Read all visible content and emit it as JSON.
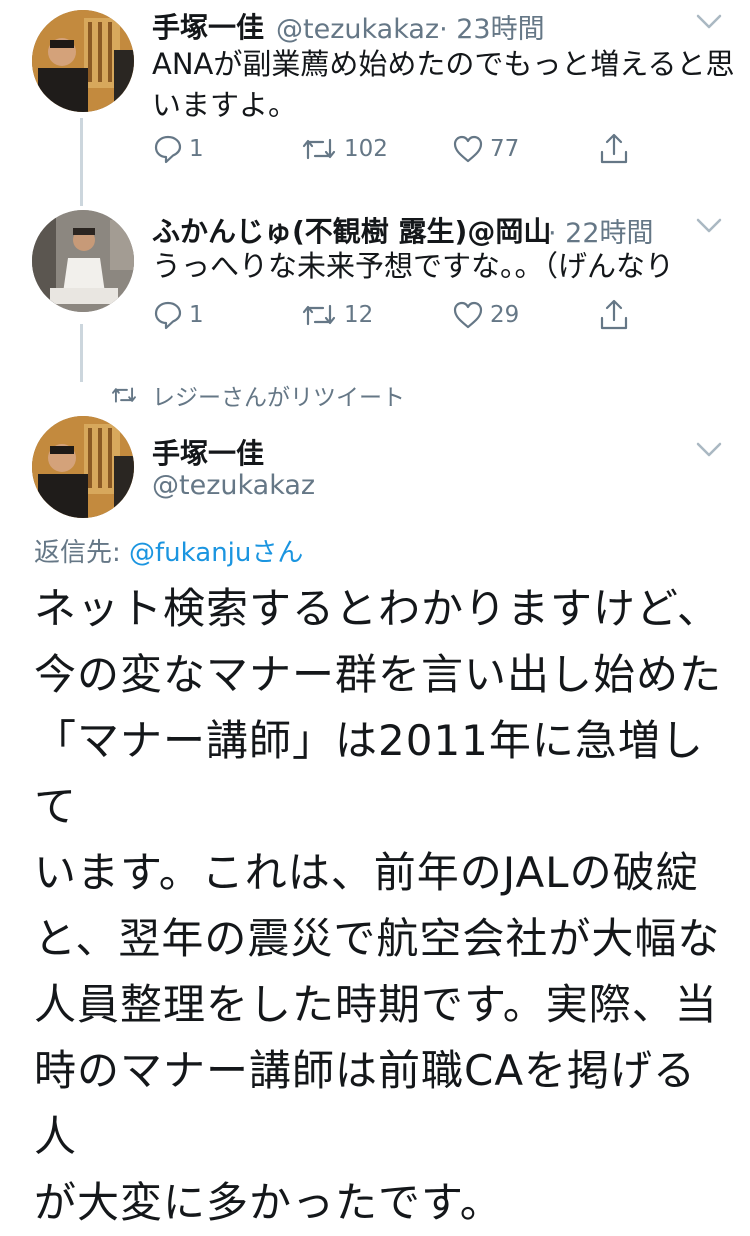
{
  "tweets": [
    {
      "name": "手塚一佳",
      "handle": "@tezukakaz",
      "time": "· 23時間",
      "text_line1": "ANAが副業薦め始めたのでもっと増えると思",
      "text_line2": "いますよ。",
      "replies": "1",
      "retweets": "102",
      "likes": "77"
    },
    {
      "name": "ふかんじゅ(不観樹 露生)@岡山",
      "time": "· 22時間",
      "text_line1": "うっへりな未来予想ですな。。（げんなり",
      "replies": "1",
      "retweets": "12",
      "likes": "29"
    }
  ],
  "retweet_banner": "レジーさんがリツイート",
  "main_tweet": {
    "name": "手塚一佳",
    "handle": "@tezukakaz",
    "reply_prefix": "返信先: ",
    "reply_handle": "@fukanju",
    "reply_suffix": "さん",
    "lines": [
      "ネット検索するとわかりますけど、",
      "今の変なマナー群を言い出し始めた",
      "「マナー講師」は2011年に急増して",
      "います。これは、前年のJALの破綻",
      "と、翌年の震災で航空会社が大幅な",
      "人員整理をした時期です。実際、当",
      "時のマナー講師は前職CAを掲げる人",
      "が大変に多かったです。"
    ]
  },
  "colors": {
    "text": "#14171a",
    "secondary": "#657786",
    "link": "#1b95e0",
    "thread_line": "#ccd6dd"
  }
}
